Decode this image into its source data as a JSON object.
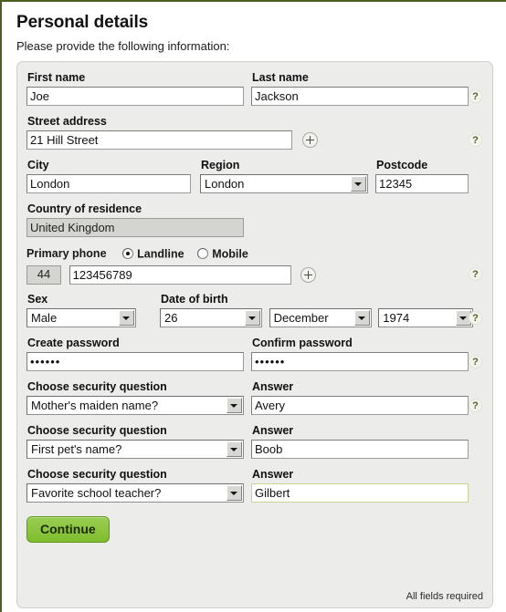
{
  "page": {
    "title": "Personal details",
    "intro": "Please provide the following information:",
    "footnote": "All fields required",
    "accent_green": "#8dc63f",
    "frame_border": "#4c5f20",
    "panel_bg": "#ececeb",
    "help_glyph": "?"
  },
  "fields": {
    "first_name": {
      "label": "First name",
      "value": "Joe"
    },
    "last_name": {
      "label": "Last name",
      "value": "Jackson"
    },
    "street_address": {
      "label": "Street address",
      "value": "21 Hill Street",
      "add_icon": "plus-icon"
    },
    "city": {
      "label": "City",
      "value": "London"
    },
    "region": {
      "label": "Region",
      "value": "London"
    },
    "postcode": {
      "label": "Postcode",
      "value": "12345"
    },
    "country": {
      "label": "Country of residence",
      "value": "United Kingdom"
    },
    "primary_phone": {
      "label": "Primary phone",
      "options": [
        {
          "label": "Landline",
          "selected": true
        },
        {
          "label": "Mobile",
          "selected": false
        }
      ],
      "prefix": "44",
      "number": "123456789",
      "add_icon": "plus-icon"
    },
    "sex": {
      "label": "Sex",
      "value": "Male"
    },
    "dob": {
      "label": "Date of birth",
      "day": "26",
      "month": "December",
      "year": "1974"
    },
    "create_password": {
      "label": "Create password",
      "value": "••••••"
    },
    "confirm_password": {
      "label": "Confirm password",
      "value": "••••••"
    },
    "security": [
      {
        "question_label": "Choose security question",
        "question": "Mother's maiden name?",
        "answer_label": "Answer",
        "answer": "Avery",
        "has_help": true,
        "answer_focused": false
      },
      {
        "question_label": "Choose security question",
        "question": "First pet's name?",
        "answer_label": "Answer",
        "answer": "Boob",
        "has_help": false,
        "answer_focused": false
      },
      {
        "question_label": "Choose security question",
        "question": "Favorite school teacher?",
        "answer_label": "Answer",
        "answer": "Gilbert",
        "has_help": false,
        "answer_focused": true
      }
    ]
  },
  "actions": {
    "continue_label": "Continue"
  }
}
